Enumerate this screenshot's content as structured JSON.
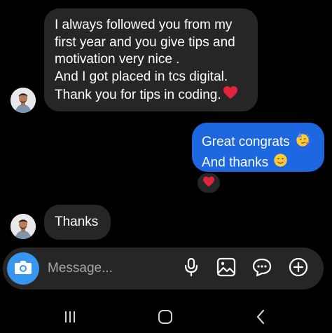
{
  "conversation": {
    "messages": [
      {
        "direction": "incoming",
        "lines": [
          "I always followed you from my",
          "first year and you give tips and",
          "motivation very nice .",
          "And I got placed in tcs digital.",
          "Thank you for tips in coding."
        ],
        "trailing_emoji": "red-heart"
      },
      {
        "direction": "outgoing",
        "lines": [
          "Great congrats",
          "And thanks"
        ],
        "line_emojis": [
          "partying-face",
          "smiling-face"
        ],
        "reaction": "red-heart"
      },
      {
        "direction": "incoming",
        "lines": [
          "Thanks"
        ]
      }
    ]
  },
  "composer": {
    "placeholder": "Message...",
    "icons": [
      "camera-icon",
      "microphone-icon",
      "gallery-icon",
      "sticker-icon",
      "add-icon"
    ]
  },
  "system_nav": {
    "icons": [
      "recent-apps-icon",
      "home-icon",
      "back-icon"
    ]
  },
  "colors": {
    "background": "#000000",
    "incoming_bubble": "#262626",
    "outgoing_bubble": "#1d68e0",
    "accent_blue": "#3797f0",
    "heart_red": "#e0243a",
    "placeholder_gray": "#a8a8a8"
  }
}
